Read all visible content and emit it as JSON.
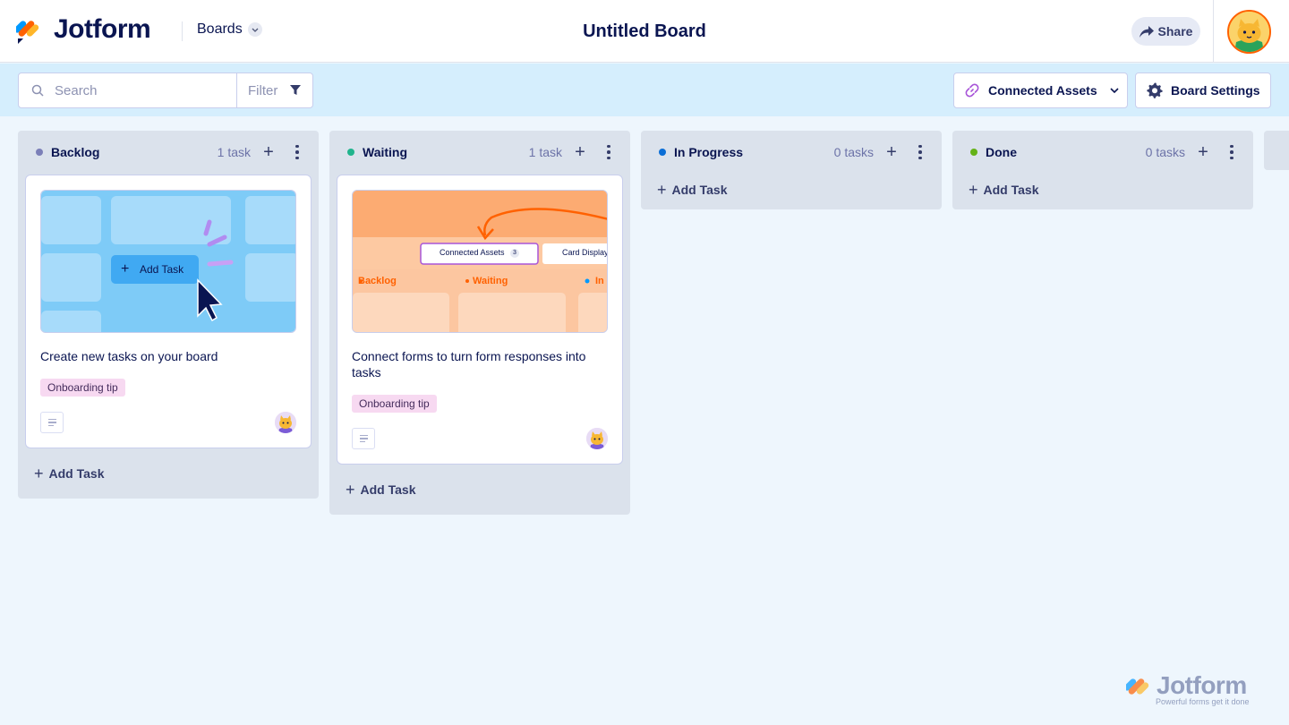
{
  "header": {
    "logo_text": "Jotform",
    "boards_label": "Boards",
    "board_title": "Untitled Board",
    "share_label": "Share"
  },
  "toolbar": {
    "search_placeholder": "Search",
    "filter_label": "Filter",
    "connected_assets_label": "Connected Assets",
    "board_settings_label": "Board Settings"
  },
  "columns": [
    {
      "title": "Backlog",
      "count": "1 task",
      "dot_color": "#7b7fb8",
      "cards": [
        {
          "title": "Create new tasks on your board",
          "tag": "Onboarding tip",
          "image_text": "Add Task"
        }
      ],
      "add_task_label": "Add Task"
    },
    {
      "title": "Waiting",
      "count": "1 task",
      "dot_color": "#20b48d",
      "cards": [
        {
          "title": "Connect forms to turn form responses into tasks",
          "tag": "Onboarding tip",
          "image_text": {
            "assets": "Connected Assets",
            "assets_count": "3",
            "display": "Card Display",
            "col1": "Backlog",
            "col2": "Waiting",
            "col3": "In"
          }
        }
      ],
      "add_task_label": "Add Task"
    },
    {
      "title": "In Progress",
      "count": "0 tasks",
      "dot_color": "#0a6ed6",
      "cards": [],
      "add_task_label": "Add Task"
    },
    {
      "title": "Done",
      "count": "0 tasks",
      "dot_color": "#64b218",
      "cards": [],
      "add_task_label": "Add Task"
    }
  ],
  "watermark": {
    "text": "Jotform",
    "tagline": "Powerful forms get it done"
  },
  "colors": {
    "brand_navy": "#0a1551",
    "brand_orange": "#ff6100",
    "toolbar_bg": "#d5eefd",
    "column_bg": "#dbe2ec",
    "tag_bg": "#f7d9f1"
  }
}
